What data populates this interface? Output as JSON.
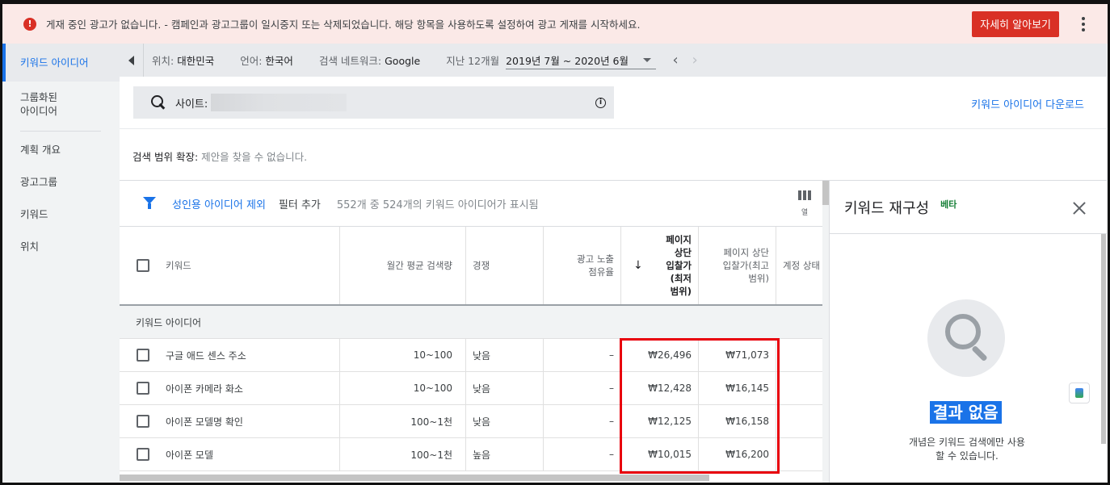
{
  "alert": {
    "text": "게재 중인 광고가 없습니다. - 캠페인과 광고그룹이 일시중지 또는 삭제되었습니다. 해당 항목을 사용하도록 설정하여 광고 게재를 시작하세요.",
    "button": "자세히 알아보기",
    "icon": "error-icon"
  },
  "sidebar": {
    "items": [
      {
        "label": "키워드 아이디어"
      },
      {
        "label": "그룹화된\n아이디어"
      },
      {
        "label": "계획 개요"
      },
      {
        "label": "광고그룹"
      },
      {
        "label": "키워드"
      },
      {
        "label": "위치"
      }
    ]
  },
  "topbar": {
    "location_label": "위치:",
    "location_value": "대한민국",
    "language_label": "언어:",
    "language_value": "한국어",
    "network_label": "검색 네트워크:",
    "network_value": "Google",
    "period_label": "지난 12개월",
    "period_value": "2019년 7월 ~ 2020년 6월"
  },
  "search": {
    "prefix": "사이트:",
    "download": "키워드 아이디어 다운로드"
  },
  "expand": {
    "label": "검색 범위 확장:",
    "value": "제안을 찾을 수 없습니다."
  },
  "filter": {
    "link": "성인용 아이디어 제외",
    "add": "필터 추가",
    "count": "552개 중 524개의 키워드 아이디어가 표시됨",
    "columns": "열"
  },
  "table": {
    "headers": {
      "keyword": "키워드",
      "volume": "월간 평균 검색량",
      "competition": "경쟁",
      "impression_share": "광고 노출\n점유율",
      "bid_low": "페이지\n상단\n입찰가\n(최저\n범위)",
      "bid_high": "페이지 상단\n입찰가(최고\n범위)",
      "account_status": "계정 상태"
    },
    "group_label": "키워드 아이디어",
    "rows": [
      {
        "keyword": "구글 애드 센스 주소",
        "volume": "10~100",
        "competition": "낮음",
        "impression": "–",
        "bid_low": "₩26,496",
        "bid_high": "₩71,073"
      },
      {
        "keyword": "아이폰 카메라 화소",
        "volume": "10~100",
        "competition": "낮음",
        "impression": "–",
        "bid_low": "₩12,428",
        "bid_high": "₩16,145"
      },
      {
        "keyword": "아이폰 모델명 확인",
        "volume": "100~1천",
        "competition": "낮음",
        "impression": "–",
        "bid_low": "₩12,125",
        "bid_high": "₩16,158"
      },
      {
        "keyword": "아이폰 모델",
        "volume": "100~1천",
        "competition": "높음",
        "impression": "–",
        "bid_low": "₩10,015",
        "bid_high": "₩16,200"
      }
    ]
  },
  "panel": {
    "title": "키워드 재구성",
    "beta": "베타",
    "no_result": "결과 없음",
    "description": "개념은 키워드 검색에만 사용\n할 수 있습니다."
  },
  "colors": {
    "accent": "#1a73e8",
    "alert_bg": "#fbe9e7",
    "alert_button": "#d93025",
    "highlight_box": "#e8000b"
  }
}
